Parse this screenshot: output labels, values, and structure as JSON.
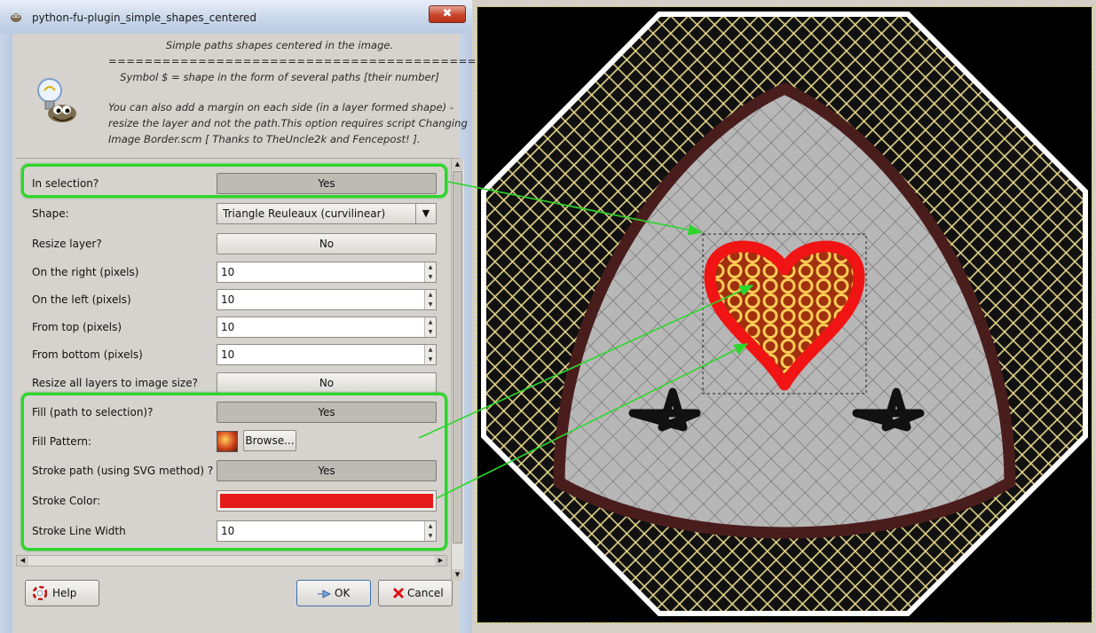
{
  "window": {
    "title": "python-fu-plugin_simple_shapes_centered",
    "close_glyph": "✖"
  },
  "description": {
    "line1": "Simple paths shapes centered in the image.",
    "line2": "==========================================",
    "line3": "Symbol $ = shape in the form of several paths [their number]",
    "line4": "You can also add a margin on each side (in a layer formed shape) -",
    "line5": "resize the layer and not the path.This option requires script Changing",
    "line6": "Image Border.scm [ Thanks to TheUncle2k and Fencepost! ]."
  },
  "form": {
    "in_selection": {
      "label": "In selection?",
      "value": "Yes"
    },
    "shape": {
      "label": "Shape:",
      "value": "Triangle Reuleaux (curvilinear)"
    },
    "resize_layer": {
      "label": "Resize layer?",
      "value": "No"
    },
    "on_right": {
      "label": "On the right (pixels)",
      "value": "10"
    },
    "on_left": {
      "label": "On the left (pixels)",
      "value": "10"
    },
    "from_top": {
      "label": "From top (pixels)",
      "value": "10"
    },
    "from_bottom": {
      "label": "From bottom (pixels)",
      "value": "10"
    },
    "resize_all": {
      "label": "Resize all layers to image size?",
      "value": "No"
    },
    "fill_path": {
      "label": "Fill (path to selection)?",
      "value": "Yes"
    },
    "fill_pattern": {
      "label": "Fill Pattern:",
      "browse": "Browse..."
    },
    "stroke_path": {
      "label": "Stroke path (using SVG method) ?",
      "value": "Yes"
    },
    "stroke_color": {
      "label": "Stroke Color:",
      "color": "#e51a1a"
    },
    "stroke_width": {
      "label": "Stroke Line Width",
      "value": "10"
    }
  },
  "buttons": {
    "help": "Help",
    "ok": "OK",
    "cancel": "Cancel"
  },
  "colors": {
    "highlight": "#2bd62b",
    "stroke": "#e51a1a",
    "shape_border": "#4a1d1d"
  },
  "icons": [
    "gimp-wilber-icon",
    "lightbulb-icon",
    "help-lifebuoy-icon",
    "ok-icon",
    "cancel-icon"
  ]
}
